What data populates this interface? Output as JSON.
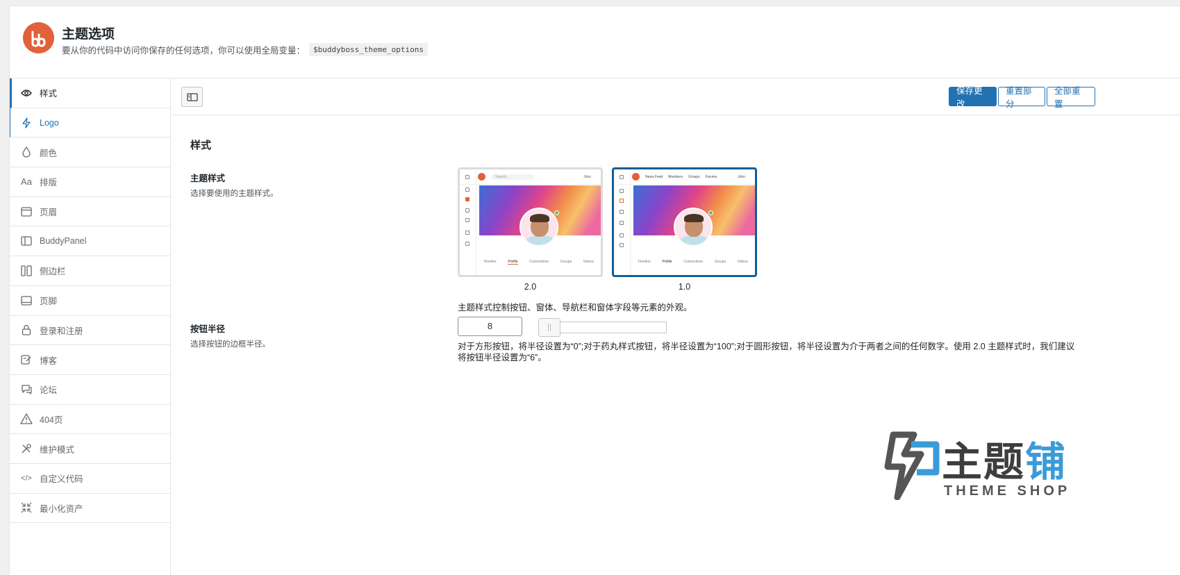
{
  "header": {
    "title": "主题选项",
    "description": "要从你的代码中访问你保存的任何选项，你可以使用全局变量：",
    "global_var": "$buddyboss_theme_options"
  },
  "sidebar": {
    "items": [
      {
        "label": "样式",
        "icon": "eye-icon"
      },
      {
        "label": "Logo",
        "icon": "bolt-icon"
      },
      {
        "label": "颜色",
        "icon": "drop-icon"
      },
      {
        "label": "排版",
        "icon": "typography-icon"
      },
      {
        "label": "页眉",
        "icon": "header-icon"
      },
      {
        "label": "BuddyPanel",
        "icon": "panel-icon"
      },
      {
        "label": "侧边栏",
        "icon": "columns-icon"
      },
      {
        "label": "页脚",
        "icon": "footer-icon"
      },
      {
        "label": "登录和注册",
        "icon": "lock-icon"
      },
      {
        "label": "博客",
        "icon": "edit-icon"
      },
      {
        "label": "论坛",
        "icon": "chat-icon"
      },
      {
        "label": "404页",
        "icon": "warning-icon"
      },
      {
        "label": "维护模式",
        "icon": "tools-icon"
      },
      {
        "label": "自定义代码",
        "icon": "code-icon"
      },
      {
        "label": "最小化资产",
        "icon": "compress-icon"
      }
    ]
  },
  "toolbar": {
    "save_label": "保存更改",
    "reset_section_label": "重置部分",
    "reset_all_label": "全部重置"
  },
  "section": {
    "title": "样式",
    "theme_style": {
      "label": "主题样式",
      "description": "选择要使用的主题样式。",
      "options": [
        {
          "caption": "2.0",
          "search": "Search...",
          "user": "John",
          "tabs": [
            "Timeline",
            "Profile",
            "Connections",
            "Groups",
            "Videos"
          ]
        },
        {
          "caption": "1.0",
          "nav": [
            "News Feed",
            "Members",
            "Groups",
            "Forums"
          ],
          "user": "John",
          "tabs": [
            "Timeline",
            "Profile",
            "Connections",
            "Groups",
            "Videos"
          ]
        }
      ],
      "selected": "1.0",
      "help": "主题样式控制按钮、窗体、导航栏和窗体字段等元素的外观。"
    },
    "button_radius": {
      "label": "按钮半径",
      "description": "选择按钮的边框半径。",
      "value": "8",
      "help": "对于方形按钮，将半径设置为“0”;对于药丸样式按钮，将半径设置为“100”;对于圆形按钮，将半径设置为介于两者之间的任何数字。使用 2.0 主题样式时，我们建议将按钮半径设置为“6”。"
    }
  },
  "watermark": {
    "text_main": "主题",
    "text_accent": "铺",
    "text_sub": "THEME SHOP"
  },
  "colors": {
    "accent": "#2271b1",
    "brand": "#e0613a"
  }
}
